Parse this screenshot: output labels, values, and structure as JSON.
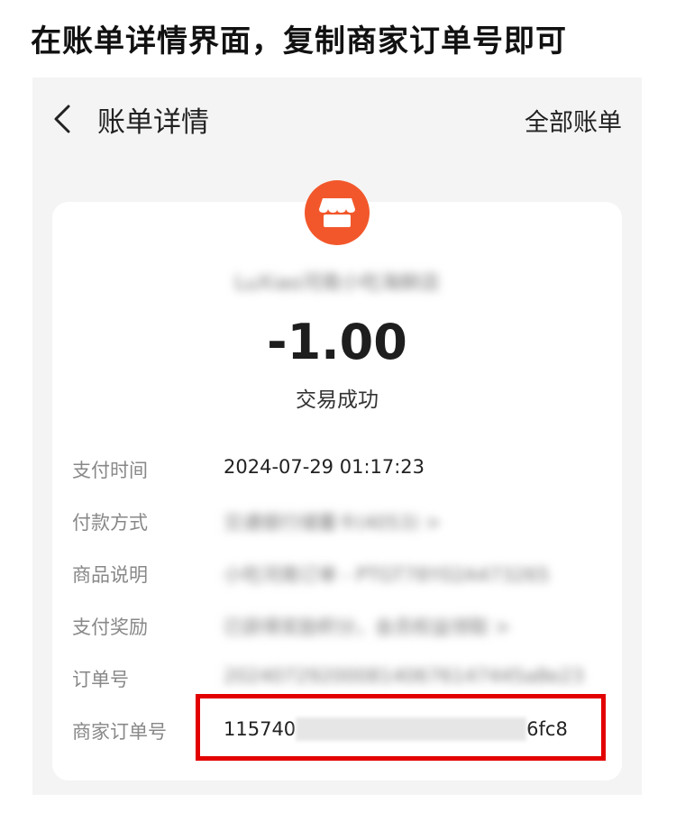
{
  "instruction": "在账单详情界面，复制商家订单号即可",
  "navbar": {
    "title": "账单详情",
    "right_label": "全部账单"
  },
  "merchant": {
    "name": "LuXiao河南小吃海鲜店",
    "logo_icon": "store-icon",
    "logo_color": "#f2572b"
  },
  "amount": "-1.00",
  "status": "交易成功",
  "details": [
    {
      "label": "支付时间",
      "value": "2024-07-29 01:17:23"
    },
    {
      "label": "付款方式",
      "value": "交通银行储蓄卡(4053) >"
    },
    {
      "label": "商品说明",
      "value": "小吃河南订单 - PTGT78Y02A473265"
    },
    {
      "label": "支付奖励",
      "value": "已获得奖励积分，会员权益领取 >"
    },
    {
      "label": "订单号",
      "value": "2024072920008140676147445a8e23"
    }
  ],
  "merchant_order": {
    "label": "商家订单号",
    "prefix": "115740",
    "suffix": "6fc8"
  },
  "highlight_color": "#e30000"
}
